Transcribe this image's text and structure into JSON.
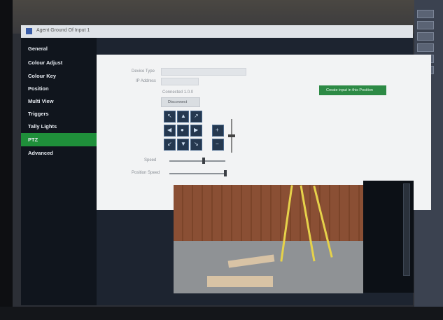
{
  "window": {
    "title": "Agent Ground Of Input 1"
  },
  "sidebar": {
    "items": [
      {
        "label": "General",
        "active": false
      },
      {
        "label": "Colour Adjust",
        "active": false
      },
      {
        "label": "Colour Key",
        "active": false
      },
      {
        "label": "Position",
        "active": false
      },
      {
        "label": "Multi View",
        "active": false
      },
      {
        "label": "Triggers",
        "active": false
      },
      {
        "label": "Tally Lights",
        "active": false
      },
      {
        "label": "PTZ",
        "active": true
      },
      {
        "label": "Advanced",
        "active": false
      }
    ]
  },
  "ptz": {
    "device_name_label": "Device Type",
    "device_name_value": "",
    "ip_address_label": "IP Address",
    "ip_address_value": "",
    "status_text": "Connected 1.0.0",
    "disconnect_label": "Disconnect",
    "create_input_label": "Create input in this Position",
    "speed_label": "Speed",
    "position_speed_label": "Position Speed",
    "speed_value": 0.6,
    "position_speed_value": 1.0
  },
  "colors": {
    "accent": "#1f8f3a",
    "sidebar_bg": "#10151d",
    "panel_bg": "#f2f3f4",
    "ptz_button": "#25384f"
  },
  "icons": {
    "pan_up_left": "arrow-up-left-icon",
    "pan_up": "arrow-up-icon",
    "pan_up_right": "arrow-up-right-icon",
    "pan_left": "arrow-left-icon",
    "home": "home-icon",
    "pan_right": "arrow-right-icon",
    "pan_down_left": "arrow-down-left-icon",
    "pan_down": "arrow-down-icon",
    "pan_down_right": "arrow-down-right-icon",
    "zoom_in": "zoom-in-icon",
    "zoom_out": "zoom-out-icon"
  }
}
